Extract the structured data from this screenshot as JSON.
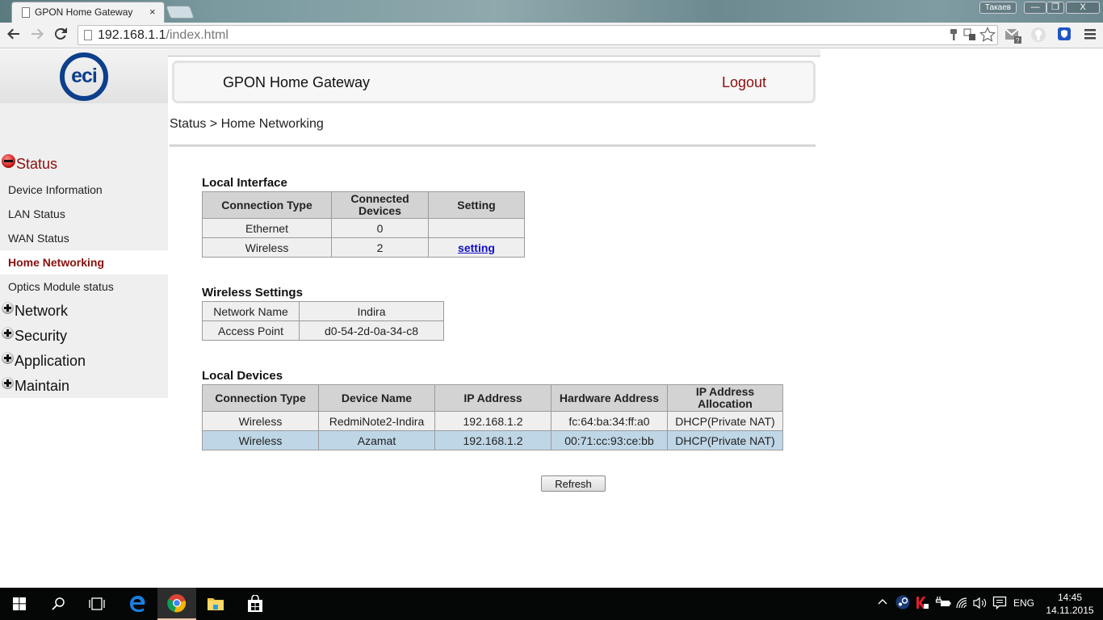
{
  "browser": {
    "tab_title": "GPON Home Gateway",
    "tab_close": "×",
    "user_badge": "Такаев",
    "window_controls": {
      "minimize": "—",
      "restore": "❐",
      "close": "X"
    },
    "url_host": "192.168.1.1",
    "url_path": "/index.html",
    "icons": [
      "back-icon",
      "forward-icon",
      "reload-icon",
      "key-icon",
      "translate-icon",
      "star-icon",
      "gmail-checker-icon",
      "lightbulb-icon",
      "shield-icon",
      "menu-icon"
    ]
  },
  "header": {
    "title": "GPON Home Gateway",
    "logout": "Logout",
    "logo_text": "eci"
  },
  "breadcrumb": "Status > Home Networking",
  "sidebar": {
    "status": {
      "label": "Status",
      "expanded": true,
      "items": [
        {
          "label": "Device Information"
        },
        {
          "label": "LAN Status"
        },
        {
          "label": "WAN Status"
        },
        {
          "label": "Home Networking",
          "active": true
        },
        {
          "label": "Optics Module status"
        }
      ]
    },
    "collapsed": [
      {
        "label": "Network"
      },
      {
        "label": "Security"
      },
      {
        "label": "Application"
      },
      {
        "label": "Maintain"
      }
    ]
  },
  "local_interface": {
    "title": "Local Interface",
    "headers": [
      "Connection Type",
      "Connected Devices",
      "Setting"
    ],
    "rows": [
      {
        "type": "Ethernet",
        "devices": "0",
        "setting": ""
      },
      {
        "type": "Wireless",
        "devices": "2",
        "setting": "setting"
      }
    ]
  },
  "wireless_settings": {
    "title": "Wireless Settings",
    "rows": [
      {
        "label": "Network Name",
        "value": "Indira"
      },
      {
        "label": "Access Point",
        "value": "d0-54-2d-0a-34-c8"
      }
    ]
  },
  "local_devices": {
    "title": "Local Devices",
    "headers": [
      "Connection Type",
      "Device Name",
      "IP Address",
      "Hardware Address",
      "IP Address Allocation"
    ],
    "rows": [
      {
        "type": "Wireless",
        "name": "RedmiNote2-Indira",
        "ip": "192.168.1.2",
        "mac": "fc:64:ba:34:ff:a0",
        "alloc": "DHCP(Private NAT)"
      },
      {
        "type": "Wireless",
        "name": "Azamat",
        "ip": "192.168.1.2",
        "mac": "00:71:cc:93:ce:bb",
        "alloc": "DHCP(Private NAT)",
        "selected": true
      }
    ]
  },
  "refresh_label": "Refresh",
  "taskbar": {
    "language": "ENG",
    "time": "14:45",
    "date": "14.11.2015",
    "apps": [
      "start-icon",
      "search-icon",
      "task-view-icon",
      "edge-icon",
      "chrome-icon",
      "file-explorer-icon",
      "store-icon"
    ],
    "tray": [
      "show-hidden-icon",
      "steam-icon",
      "kaspersky-icon",
      "battery-icon",
      "wifi-icon",
      "volume-icon",
      "notifications-icon"
    ]
  },
  "colors": {
    "accent_red": "#8b0f0f",
    "logo_blue": "#0c3f8c",
    "link_blue": "#1010cc",
    "selected_row": "#bfd6e6"
  }
}
